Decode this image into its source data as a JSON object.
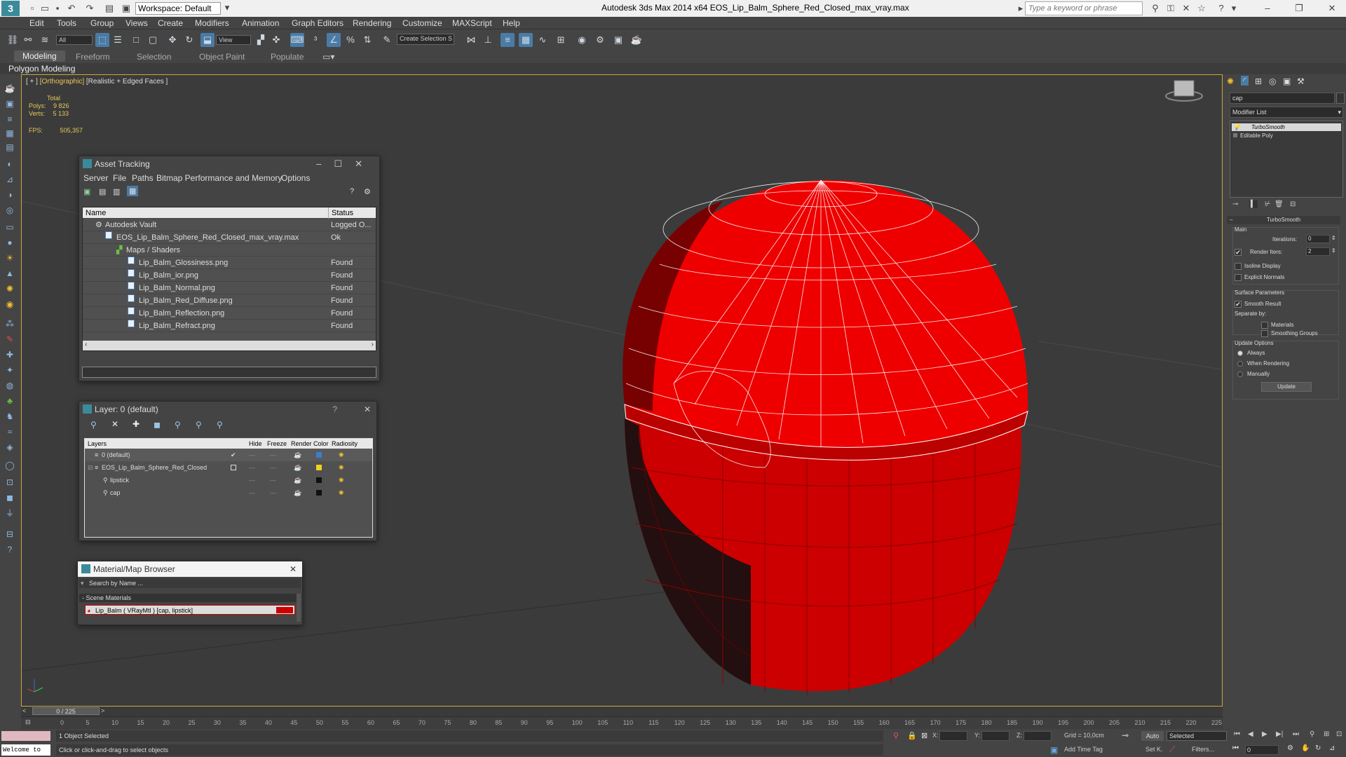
{
  "titlebar": {
    "workspace": "Workspace: Default",
    "app_title": "Autodesk 3ds Max  2014 x64     EOS_Lip_Balm_Sphere_Red_Closed_max_vray.max",
    "search_placeholder": "Type a keyword or phrase"
  },
  "menu": [
    "Edit",
    "Tools",
    "Group",
    "Views",
    "Create",
    "Modifiers",
    "Animation",
    "Graph Editors",
    "Rendering",
    "Customize",
    "MAXScript",
    "Help"
  ],
  "toolbar": {
    "filter": "All",
    "refcoord": "View",
    "selection_set": "Create Selection S"
  },
  "ribbon": {
    "tabs": [
      "Modeling",
      "Freeform",
      "Selection",
      "Object Paint",
      "Populate"
    ],
    "sub": "Polygon Modeling"
  },
  "viewport": {
    "label_plus": "[ + ]",
    "label_view": "[Orthographic]",
    "label_shading": "[Realistic + Edged Faces ]",
    "stats_total": "Total",
    "polys_label": "Polys:",
    "polys": "9 826",
    "verts_label": "Verts:",
    "verts": "5 133",
    "fps_label": "FPS:",
    "fps": "505,357"
  },
  "asset_tracking": {
    "title": "Asset Tracking",
    "menu": [
      "Server",
      "File",
      "Paths",
      "Bitmap Performance and Memory",
      "Options"
    ],
    "col_name": "Name",
    "col_status": "Status",
    "rows": [
      {
        "name": "Autodesk Vault",
        "status": "Logged O..."
      },
      {
        "name": "EOS_Lip_Balm_Sphere_Red_Closed_max_vray.max",
        "status": "Ok"
      },
      {
        "name": "Maps / Shaders",
        "status": ""
      },
      {
        "name": "Lip_Balm_Glossiness.png",
        "status": "Found"
      },
      {
        "name": "Lip_Balm_ior.png",
        "status": "Found"
      },
      {
        "name": "Lip_Balm_Normal.png",
        "status": "Found"
      },
      {
        "name": "Lip_Balm_Red_Diffuse.png",
        "status": "Found"
      },
      {
        "name": "Lip_Balm_Reflection.png",
        "status": "Found"
      },
      {
        "name": "Lip_Balm_Refract.png",
        "status": "Found"
      }
    ]
  },
  "layer_window": {
    "title": "Layer: 0 (default)",
    "help": "?",
    "cols": [
      "Layers",
      "Hide",
      "Freeze",
      "Render",
      "Color",
      "Radiosity"
    ],
    "rows": [
      "0 (default)",
      "EOS_Lip_Balm_Sphere_Red_Closed",
      "lipstick",
      "cap"
    ],
    "colors": [
      "#3a7fd0",
      "#f0d020",
      "#111111",
      "#111111"
    ]
  },
  "material_browser": {
    "title": "Material/Map Browser",
    "search": "Search by Name ...",
    "group": "- Scene Materials",
    "item": "Lip_Balm  ( VRayMtl )  [cap, lipstick]"
  },
  "command_panel": {
    "object_name": "cap",
    "modifier_list": "Modifier List",
    "stack": [
      "TurboSmooth",
      "Editable Poly"
    ],
    "rollout_title": "TurboSmooth",
    "main_label": "Main",
    "iterations_label": "Iterations:",
    "iterations": "0",
    "render_iters_label": "Render Iters:",
    "render_iters": "2",
    "isoline": "Isoline Display",
    "explicit": "Explicit Normals",
    "surface_label": "Surface Parameters",
    "smooth_result": "Smooth Result",
    "separate_by": "Separate by:",
    "materials": "Materials",
    "smoothing_groups": "Smoothing Groups",
    "update_label": "Update Options",
    "always": "Always",
    "when_rendering": "When Rendering",
    "manually": "Manually",
    "update_button": "Update"
  },
  "timeline": {
    "frame": "0 / 225",
    "ticks": [
      "0",
      "5",
      "10",
      "15",
      "20",
      "25",
      "30",
      "35",
      "40",
      "45",
      "50",
      "55",
      "60",
      "65",
      "70",
      "75",
      "80",
      "85",
      "90",
      "95",
      "100",
      "105",
      "110",
      "115",
      "120",
      "125",
      "130",
      "135",
      "140",
      "145",
      "150",
      "155",
      "160",
      "165",
      "170",
      "175",
      "180",
      "185",
      "190",
      "195",
      "200",
      "205",
      "210",
      "215",
      "220",
      "225"
    ]
  },
  "status": {
    "welcome": "Welcome to",
    "selected": "1 Object Selected",
    "hint": "Click or click-and-drag to select objects",
    "x": "X:",
    "y": "Y:",
    "z": "Z:",
    "grid": "Grid = 10,0cm",
    "add_time_tag": "Add Time Tag",
    "auto": "Auto",
    "selected_dd": "Selected",
    "setk": "Set K.",
    "filters": "Filters...",
    "frame_field": "0"
  }
}
